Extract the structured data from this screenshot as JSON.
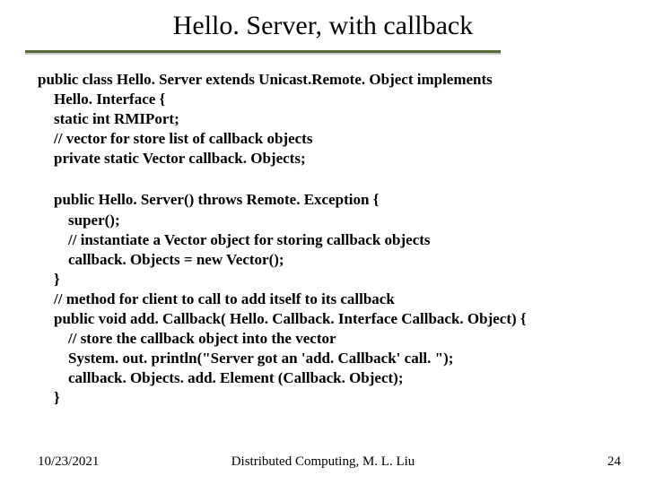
{
  "title": "Hello. Server, with callback",
  "block1": {
    "l1": "public class Hello. Server extends Unicast.Remote. Object implements",
    "l2": "Hello. Interface {",
    "l3": "static int RMIPort;",
    "l4": "// vector for store list of callback objects",
    "l5": "private static Vector callback. Objects;"
  },
  "block2": {
    "l1": "public Hello. Server() throws Remote. Exception {",
    "l2": "super();",
    "l3": "// instantiate a Vector object for storing callback objects",
    "l4": "callback. Objects = new Vector();",
    "l5": "}",
    "l6": "// method for client to call to add itself to its callback",
    "l7": "public void add. Callback(  Hello. Callback. Interface Callback. Object) {",
    "l8": "// store the callback object into the vector",
    "l9": "System. out. println(\"Server got an 'add. Callback' call. \");",
    "l10": "callback. Objects. add. Element (Callback. Object);",
    "l11": "}"
  },
  "footer": {
    "date": "10/23/2021",
    "center": "Distributed Computing, M. L. Liu",
    "page": "24"
  }
}
